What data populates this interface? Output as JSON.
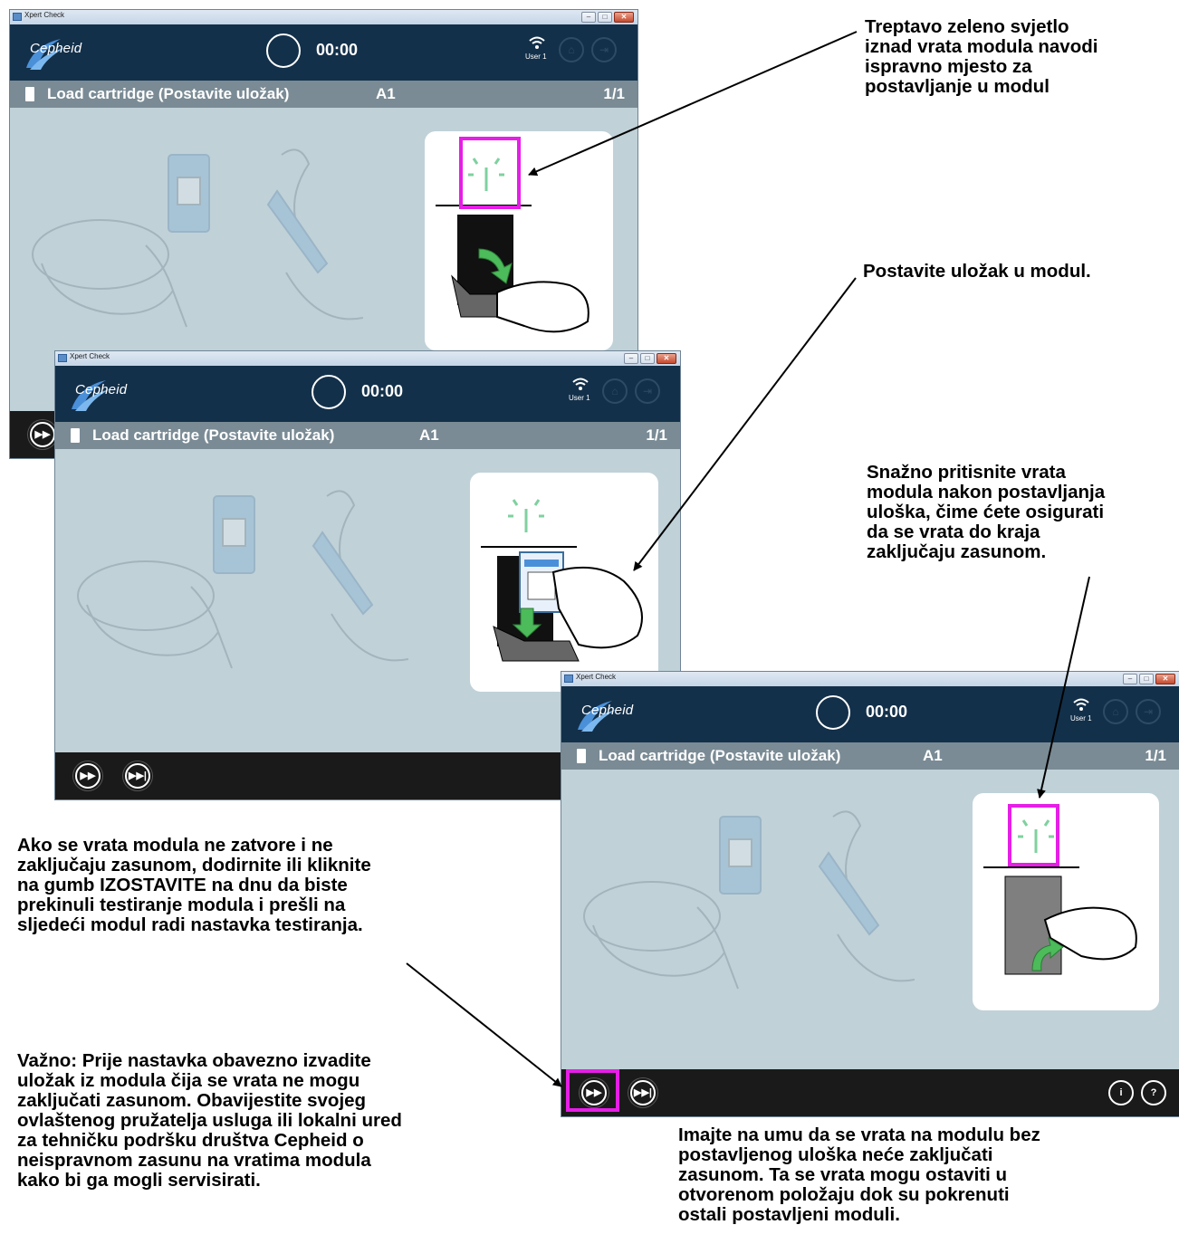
{
  "window": {
    "title": "Xpert Check",
    "minimize_glyph": "–",
    "maximize_glyph": "□",
    "close_glyph": "✕"
  },
  "app": {
    "logo_text": "Cepheid",
    "timer": "00:00",
    "user": "User 1",
    "step_label": "Load cartridge",
    "step_label_local": "(Postavite uložak)",
    "module": "A1",
    "page": "1/1",
    "home_icon": "home-icon",
    "logout_icon": "logout-icon"
  },
  "controls": {
    "fast_forward_glyph": "▶▶",
    "skip_glyph": "▶▶|",
    "info_glyph": "i",
    "help_glyph": "?"
  },
  "colors": {
    "appbar": "#13304a",
    "stepbar": "#7a8b95",
    "content_bg": "#c0d1d8",
    "bottombar": "#1a1a1a",
    "highlight": "#e61ee6",
    "light_green": "#7fd19f",
    "arrow_green": "#4cbb5a"
  },
  "annotations": {
    "green_light": [
      "Treptavo zeleno svjetlo",
      "iznad vrata modula navodi",
      "ispravno mjesto za",
      "postavljanje u modul"
    ],
    "insert": [
      "Postavite uložak u modul."
    ],
    "press_door": [
      "Snažno pritisnite vrata",
      "modula nakon postavljanja",
      "uloška, čime ćete osigurati",
      "da se vrata do kraja",
      "zaključaju zasunom."
    ],
    "skip": [
      "Ako se vrata modula ne zatvore i ne",
      "zaključaju zasunom, dodirnite ili kliknite",
      "na gumb IZOSTAVITE na dnu da biste",
      "prekinuli testiranje modula i prešli na",
      "sljedeći modul radi nastavka testiranja."
    ],
    "important": [
      "Važno: Prije nastavka obavezno izvadite",
      "uložak iz modula čija se vrata ne mogu",
      "zaključati zasunom. Obavijestite svojeg",
      "ovlaštenog pružatelja usluga ili lokalni ured",
      "za tehničku podršku društva Cepheid o",
      "neispravnom zasunu na vratima modula",
      "kako bi ga mogli servisirati."
    ],
    "empty_modules": [
      "Imajte na umu da se vrata na modulu bez",
      "postavljenog uloška neće zaključati",
      "zasunom. Ta se vrata mogu ostaviti u",
      "otvorenom položaju dok su pokrenuti",
      "ostali postavljeni moduli."
    ]
  }
}
